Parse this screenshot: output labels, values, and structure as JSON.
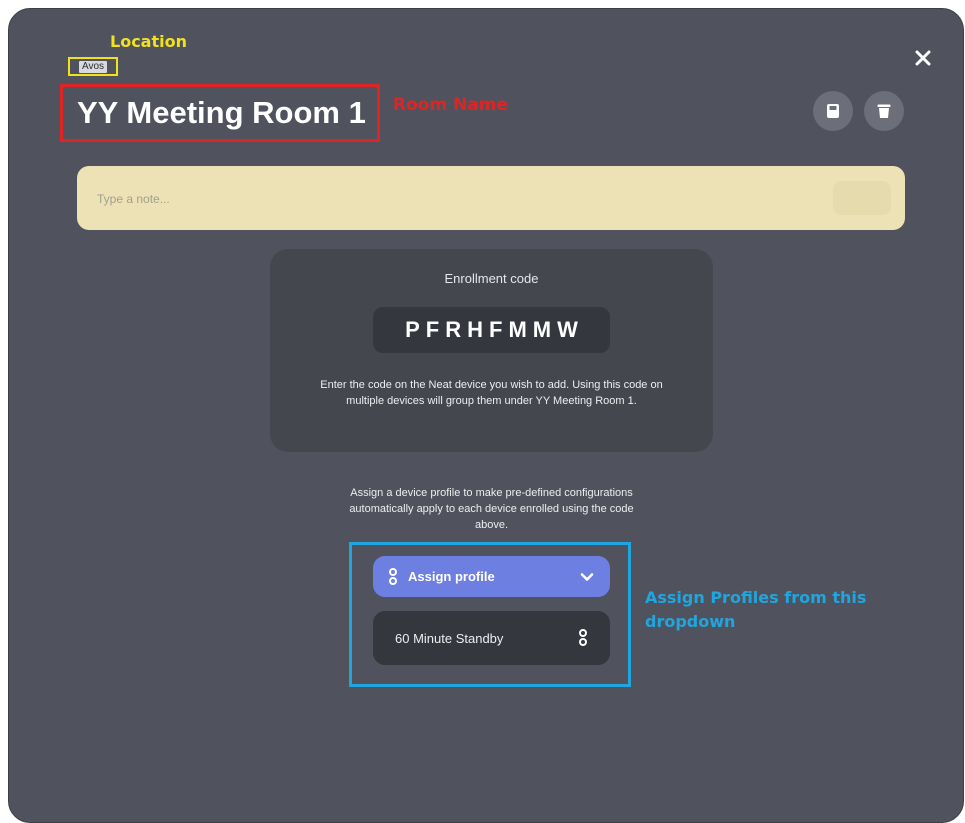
{
  "annotations": {
    "location_label": "Location",
    "room_name_label": "Room Name",
    "profile_label": "Assign Profiles from this dropdown",
    "colors": {
      "location": "#f2e21b",
      "room_name": "#e02424",
      "profile": "#1fa5e0"
    }
  },
  "header": {
    "location": "Avos",
    "room_name": "YY Meeting Room 1",
    "close_icon": "close-icon",
    "actions": [
      {
        "icon": "save-icon"
      },
      {
        "icon": "trash-icon"
      }
    ]
  },
  "note": {
    "placeholder": "Type a note...",
    "value": ""
  },
  "enrollment": {
    "title": "Enrollment code",
    "code": "PFRHFMMW",
    "description": "Enter the code on the Neat device you wish to add. Using this code on multiple devices will group them under YY Meeting Room 1."
  },
  "profile": {
    "description": "Assign a device profile to make pre-defined configurations automatically apply to each device enrolled using the code above.",
    "assign_button_label": "Assign profile",
    "options": [
      {
        "label": "60 Minute Standby",
        "icon": "profile-icon"
      }
    ]
  },
  "colors": {
    "modal_bg": "#50535d",
    "card_bg": "#45474f",
    "note_bg": "#ede2b6",
    "accent": "#6d7fe0"
  }
}
